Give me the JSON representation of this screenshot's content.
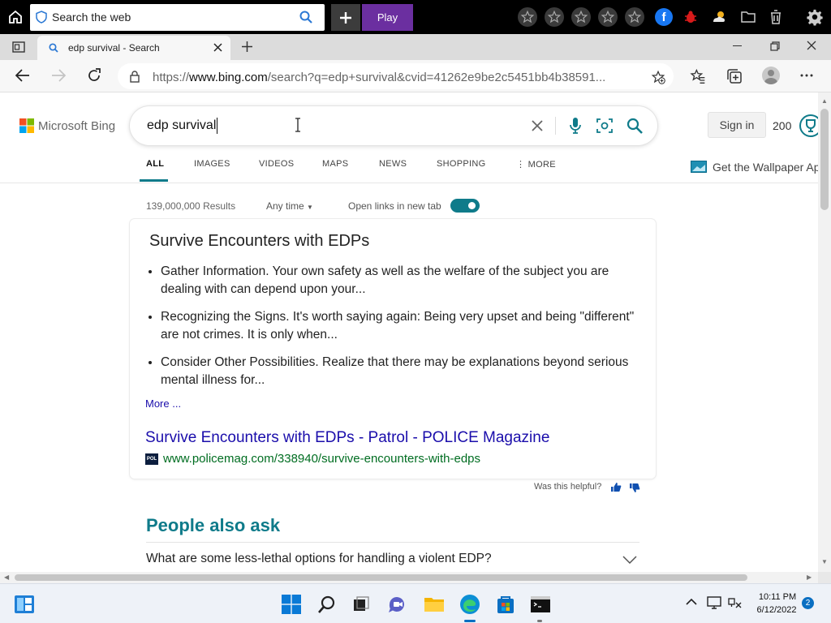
{
  "topbar": {
    "search_placeholder": "Search the web",
    "play_label": "Play"
  },
  "tab": {
    "title": "edp survival - Search"
  },
  "address": {
    "url_prefix": "https://",
    "url_host": "www.bing.com",
    "url_rest": "/search?q=edp+survival&cvid=41262e9be2c5451bb4b38591..."
  },
  "bing": {
    "logo_text": "Microsoft Bing",
    "query": "edp survival",
    "sign_in": "Sign in",
    "rewards_count": "200",
    "wallpaper_promo": "Get the Wallpaper Ap",
    "nav": [
      "ALL",
      "IMAGES",
      "VIDEOS",
      "MAPS",
      "NEWS",
      "SHOPPING",
      "MORE"
    ],
    "results_count": "139,000,000 Results",
    "time_filter": "Any time",
    "open_links_label": "Open links in new tab"
  },
  "answer": {
    "title": "Survive Encounters with EDPs",
    "bullets": [
      "Gather Information. Your own safety as well as the welfare of the subject you are dealing with can depend upon your...",
      "Recognizing the Signs. It's worth saying again: Being very upset and being \"different\" are not crimes. It is only when...",
      "Consider Other Possibilities. Realize that there may be explanations beyond serious mental illness for..."
    ],
    "more_link": "More ...",
    "source_title": "Survive Encounters with EDPs - Patrol - POLICE Magazine",
    "source_url": "www.policemag.com/338940/survive-encounters-with-edps",
    "source_icon_text": "POL",
    "helpful_text": "Was this helpful?"
  },
  "paa": {
    "heading": "People also ask",
    "question": "What are some less-lethal options for handling a violent EDP?"
  },
  "taskbar": {
    "time": "10:11 PM",
    "date": "6/12/2022",
    "notification_count": "2"
  },
  "colors": {
    "bing_teal": "#0f7b8a",
    "link_blue": "#1a0dab",
    "url_green": "#006d21",
    "play_purple": "#6b2fa0"
  }
}
